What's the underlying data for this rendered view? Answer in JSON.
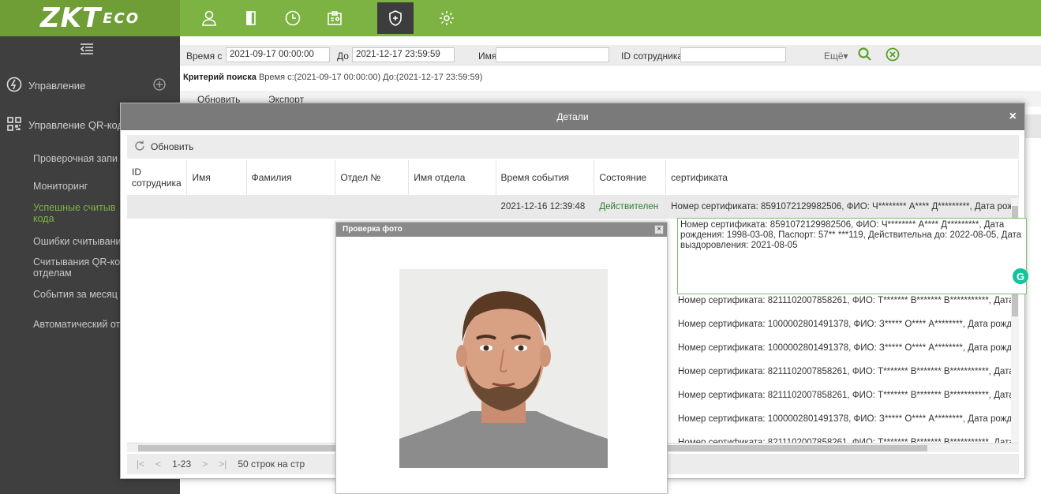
{
  "brand": {
    "logo": "ZKT",
    "logo_suffix": "ECO"
  },
  "topnav": {
    "icons": [
      "user-icon",
      "door-icon",
      "clock-icon",
      "badge-icon",
      "shield-plus-icon",
      "gear-icon"
    ],
    "active": "shield-plus-icon"
  },
  "sidebar": {
    "items": [
      {
        "label": "Управление"
      },
      {
        "label": "Управление QR-код"
      }
    ],
    "subitems": [
      {
        "label": "Проверочная запи"
      },
      {
        "label": "Мониторинг"
      },
      {
        "label": "Успешные считыв",
        "label2": "кода",
        "active": true
      },
      {
        "label": "Ошибки считывани"
      },
      {
        "label": "Считывания QR-ко",
        "label2": "отделам"
      },
      {
        "label": "События за месяц"
      },
      {
        "label": "Автоматический от"
      }
    ]
  },
  "filter": {
    "time_from_label": "Время с",
    "time_from": "2021-09-17 00:00:00",
    "time_to_label": "До",
    "time_to": "2021-12-17 23:59:59",
    "name_label": "Имя",
    "name_value": "",
    "emp_id_label": "ID сотрудника",
    "emp_id_value": "",
    "more": "Ещё▾"
  },
  "criteria": {
    "label": "Критерий поиска",
    "text": "Время с:(2021-09-17 00:00:00) До:(2021-12-17 23:59:59)"
  },
  "main_toolbar": {
    "refresh": "Обновить",
    "export": "Экспорт"
  },
  "dialog": {
    "title": "Детали",
    "close": "×",
    "refresh": "Обновить",
    "columns": [
      "ID сотрудника",
      "Имя",
      "Фамилия",
      "Отдел №",
      "Имя отдела",
      "Время события",
      "Состояние",
      "сертификата"
    ],
    "first_row": {
      "time": "2021-12-16 12:39:48",
      "status": "Действителен",
      "cert": "Номер сертификата: 8591072129982506, ФИО: Ч******** А**** Д*********, Дата рож"
    },
    "cert_rows": [
      "Номер сертификата: 8211102007858261, ФИО: Т******* В******* В***********, Дата",
      "Номер сертификата: 1000002801491378, ФИО: З***** О**** А********, Дата рожд",
      "Номер сертификата: 1000002801491378, ФИО: З***** О**** А********, Дата рожд",
      "Номер сертификата: 8211102007858261, ФИО: Т******* В******* В***********, Дата",
      "Номер сертификата: 8211102007858261, ФИО: Т******* В******* В***********, Дата",
      "Номер сертификата: 1000002801491378, ФИО: З***** О**** А********, Дата рожд",
      "Номер сертификата: 8211102007858261, ФИО: Т******* В******* В***********, Дата"
    ],
    "pager": {
      "first": "|<",
      "prev": "<",
      "range": "1-23",
      "next": ">",
      "last": ">|",
      "per_page": "50 строк на стр"
    }
  },
  "photo_popup": {
    "title": "Проверка фото",
    "close": "×"
  },
  "tooltip": {
    "text": "Номер сертификата: 8591072129982506, ФИО: Ч******** А**** Д*********, Дата рождения: 1998-03-08, Паспорт: 57** ***119, Действительна до: 2022-08-05, Дата выздоровления: 2021-08-05"
  },
  "grammarly": "G",
  "colors": {
    "topbar": "#7cb342",
    "sidebar": "#3f3f3f",
    "valid": "#2e7d32",
    "accent": "#15c39a"
  }
}
